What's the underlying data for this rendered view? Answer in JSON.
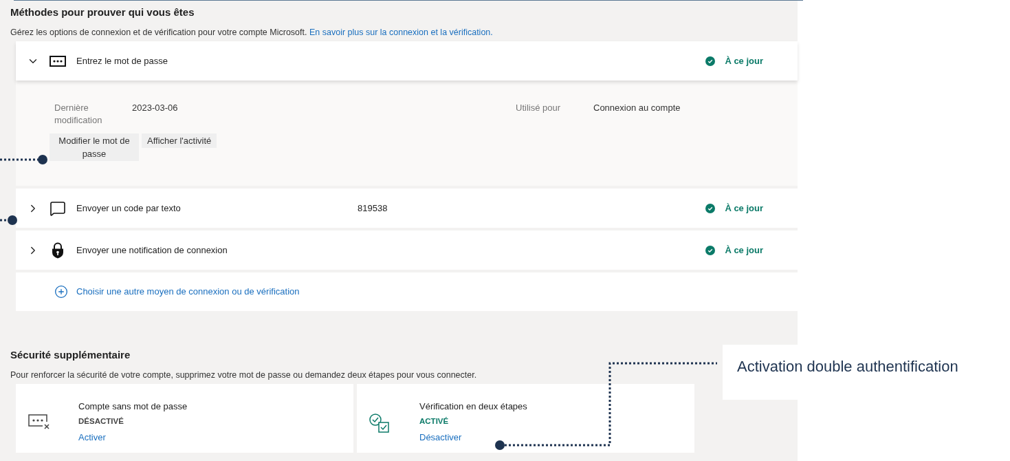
{
  "methods_section": {
    "title": "Méthodes pour prouver qui vous êtes",
    "description": "Gérez les options de connexion et de vérification pour votre compte Microsoft.",
    "learn_more_link": "En savoir plus sur la connexion et la vérification.",
    "methods": [
      {
        "kind": "password",
        "label": "Entrez le mot de passe",
        "status": "À ce jour",
        "expanded": true,
        "details": {
          "last_modified_label": "Dernière modification",
          "last_modified_value": "2023-03-06",
          "used_for_label": "Utilisé pour",
          "used_for_value": "Connexion au compte",
          "buttons": [
            "Modifier le mot de passe",
            "Afficher l'activité"
          ]
        }
      },
      {
        "kind": "sms",
        "label": "Envoyer un code par texto",
        "value": "819538",
        "status": "À ce jour",
        "expanded": false
      },
      {
        "kind": "notification",
        "label": "Envoyer une notification de connexion",
        "status": "À ce jour",
        "expanded": false
      }
    ],
    "add_method_link": "Choisir une autre moyen de connexion ou de vérification"
  },
  "extra_security": {
    "title": "Sécurité supplémentaire",
    "description": "Pour renforcer la sécurité de votre compte, supprimez votre mot de passe ou demandez deux étapes pour vous connecter.",
    "cards": [
      {
        "kind": "passwordless",
        "title": "Compte sans mot de passe",
        "status": "DÉSACTIVÉ",
        "active": false,
        "action": "Activer"
      },
      {
        "kind": "two_step",
        "title": "Vérification en deux étapes",
        "status": "ACTIVÉ",
        "active": true,
        "action": "Désactiver"
      }
    ]
  },
  "annotation": {
    "label": "Activation double authentification"
  }
}
